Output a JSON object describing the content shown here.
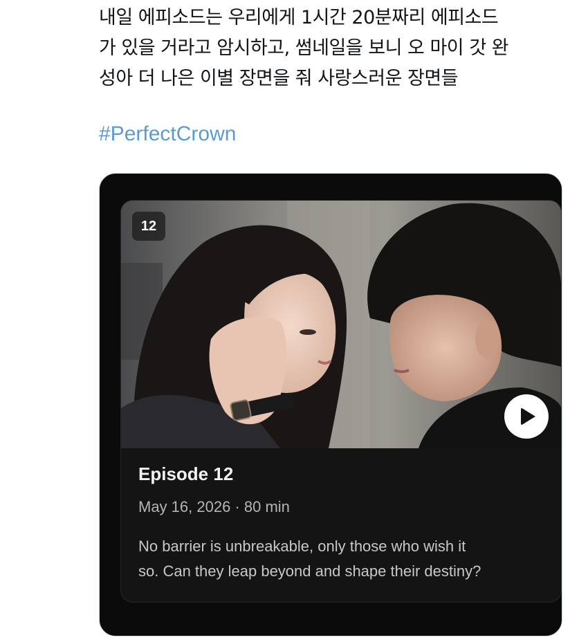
{
  "tweet": {
    "text_lines": [
      "내일 에피소드는 우리에게 1시간 20분짜리 에피소드",
      "가 있을 거라고 암시하고, 썸네일을 보니 오 마이 갓 완",
      "성아 더 나은 이별 장면을 줘 사랑스러운 장면들"
    ],
    "hashtag": "#PerfectCrown",
    "hashtag_color": "#5b9bd5"
  },
  "episode_card": {
    "badge": "12",
    "title": "Episode 12",
    "date": "May 16, 2026",
    "separator": " · ",
    "duration": "80 min",
    "description_lines": [
      "No barrier is unbreakable, only those who wish it",
      "so. Can they leap beyond and shape their destiny?"
    ],
    "play_icon": "play-icon"
  },
  "colors": {
    "card_background": "#141414",
    "frame_background": "#0b0b0b",
    "title_text": "#f2f2f2",
    "meta_text": "#b5b5b5"
  }
}
